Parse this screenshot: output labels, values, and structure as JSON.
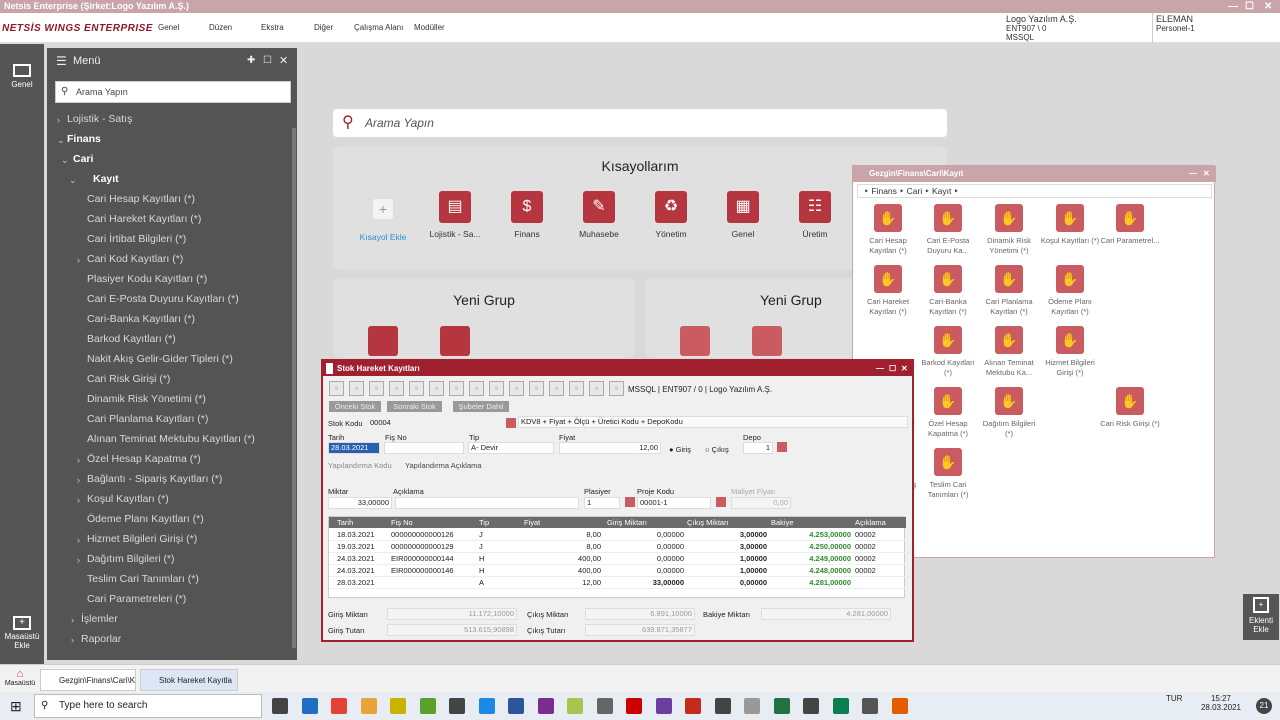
{
  "window_title": "Netsis Enterprise (Şirket:Logo Yazılım A.Ş.)",
  "app_logo": "NETSİS WINGS ENTERPRISE",
  "top_menu": [
    "Genel",
    "Düzen",
    "Ekstra",
    "Diğer",
    "Çalışma Alanı",
    "Modüller"
  ],
  "company": {
    "name": "Logo Yazılım A.Ş.",
    "db": "ENT907 \\ 0",
    "server": "MSSQL"
  },
  "user": {
    "role": "ELEMAN",
    "name": "Personel-1"
  },
  "rail": {
    "genel": "Genel",
    "desktop_add": "Masaüstü Ekle"
  },
  "menu": {
    "title": "Menü",
    "search_placeholder": "Arama Yapın",
    "items": [
      "Lojistik - Satış",
      "Finans",
      "Cari",
      "Kayıt",
      "Cari Hesap Kayıtları (*)",
      "Cari Hareket Kayıtları (*)",
      "Cari İrtibat Bilgileri (*)",
      "Cari Kod Kayıtları (*)",
      "Plasiyer Kodu Kayıtları (*)",
      "Cari E-Posta Duyuru Kayıtları (*)",
      "Cari-Banka Kayıtları (*)",
      "Barkod Kayıtları (*)",
      "Nakit Akış Gelir-Gider Tipleri (*)",
      "Cari Risk Girişi (*)",
      "Dinamik Risk Yönetimi (*)",
      "Cari Planlama Kayıtları (*)",
      "Alınan Teminat Mektubu Kayıtları (*)",
      "Özel Hesap Kapatma (*)",
      "Bağlantı - Sipariş Kayıtları (*)",
      "Koşul Kayıtları (*)",
      "Ödeme Planı Kayıtları (*)",
      "Hizmet Bilgileri Girişi (*)",
      "Dağıtım Bilgileri (*)",
      "Teslim Cari Tanımları (*)",
      "Cari Parametreleri (*)",
      "İşlemler",
      "Raporlar"
    ]
  },
  "main": {
    "search_placeholder": "Arama Yapın",
    "shortcuts_title": "Kısayollarım",
    "add_shortcut": "Kısayol Ekle",
    "shortcuts": [
      "Lojistik - Sa...",
      "Finans",
      "Muhasebe",
      "Yönetim",
      "Genel",
      "Üretim"
    ],
    "group1": "Yeni Grup",
    "group2": "Yeni Grup"
  },
  "gezgin": {
    "title": "Gezgin\\Finans\\Cari\\Kayıt",
    "breadcrumb": [
      "Finans",
      "Cari",
      "Kayıt"
    ],
    "tiles": [
      "Cari Hesap Kayıtları (*)",
      "Cari E-Posta Duyuru Ka...",
      "Dinamik Risk Yönetimi (*)",
      "Koşul Kayıtları (*)",
      "Cari Parametrel...",
      "Cari Hareket Kayıtları (*)",
      "Cari-Banka Kayıtları (*)",
      "Cari Planlama Kayıtları (*)",
      "Ödeme Planı Kayıtları (*)",
      "",
      "",
      "Barkod Kayıtları (*)",
      "Alınan Teminat Mektubu Ka...",
      "Hizmet Bilgileri Girişi (*)",
      "",
      "Nakit Akış Gelir-Gid...",
      "Özel Hesap Kapatma (*)",
      "Dağıtım Bilgileri (*)",
      "",
      "Cari Risk Girişi (*)",
      "Bağlantı - Sipariş K...",
      "Teslim Cari Tanımları (*)"
    ]
  },
  "stok": {
    "title": "Stok Hareket Kayıtları",
    "conn": "MSSQL | ENT907 / 0 | Logo Yazılım A.Ş.",
    "prev": "Önceki Stok",
    "next": "Sonraki Stok",
    "branch": "Şubeler Dahil",
    "stok_kodu_label": "Stok Kodu",
    "stok_kodu": "00004",
    "kdv": "KDV8 + Fiyat + Ölçü + Üretici Kodu + DepoKodu",
    "tarih_label": "Tarih",
    "fisno_label": "Fiş No",
    "tip_label": "Tip",
    "fiyat_label": "Fiyat",
    "depo_label": "Depo",
    "tarih": "28.03.2021",
    "tip": "A- Devir",
    "fiyat": "12,00",
    "giris": "Giriş",
    "cikis": "Çıkış",
    "depo": "1",
    "yap_kod": "Yapılandırma Kodu",
    "yap_acik": "Yapılandırma Açıklama",
    "miktar_label": "Miktar",
    "aciklama_label": "Açıklama",
    "plasiyer_label": "Plasiyer",
    "proje_label": "Proje Kodu",
    "maliyet_label": "Maliyet Fiyatı",
    "miktar": "33,00000",
    "plasiyer": "1",
    "proje": "00001-1",
    "maliyet": "0,00",
    "columns": [
      "Tarih",
      "Fiş No",
      "Tip",
      "Fiyat",
      "Giriş Miktarı",
      "Çıkış Miktarı",
      "Bakiye",
      "Açıklama"
    ],
    "rows": [
      [
        "18.03.2021",
        "000000000000126",
        "J",
        "8,00",
        "0,00000",
        "3,00000",
        "4.253,00000",
        "00002"
      ],
      [
        "19.03.2021",
        "000000000000129",
        "J",
        "8,00",
        "0,00000",
        "3,00000",
        "4.250,00000",
        "00002"
      ],
      [
        "24.03.2021",
        "EIR000000000144",
        "H",
        "400,00",
        "0,00000",
        "1,00000",
        "4.249,00000",
        "00002"
      ],
      [
        "24.03.2021",
        "EIR000000000146",
        "H",
        "400,00",
        "0,00000",
        "1,00000",
        "4.248,00000",
        "00002"
      ],
      [
        "28.03.2021",
        "",
        "A",
        "12,00",
        "33,00000",
        "0,00000",
        "4.281,00000",
        ""
      ]
    ],
    "giris_miktari_label": "Giriş Miktarı",
    "giris_miktari": "11.172,10000",
    "cikis_miktari_label": "Çıkış Miktarı",
    "cikis_miktari": "6.891,10000",
    "bakiye_label": "Bakiye Miktarı",
    "bakiye": "4.281,00000",
    "giris_tutari_label": "Giriş Tutarı",
    "giris_tutari": "513.615,90898",
    "cikis_tutari_label": "Çıkış Tutarı",
    "cikis_tutari": "639.871,35877"
  },
  "right_rail": {
    "add_extension": "Eklenti Ekle"
  },
  "apptabs": {
    "masaustu": "Masaüstü",
    "gezgin": "Gezgin\\Finans\\Cari\\K",
    "stok": "Stok Hareket Kayıtla"
  },
  "taskbar": {
    "search": "Type here to search",
    "time": "15:27",
    "date": "28.03.2021",
    "lang": "TUR",
    "badge": "21"
  }
}
